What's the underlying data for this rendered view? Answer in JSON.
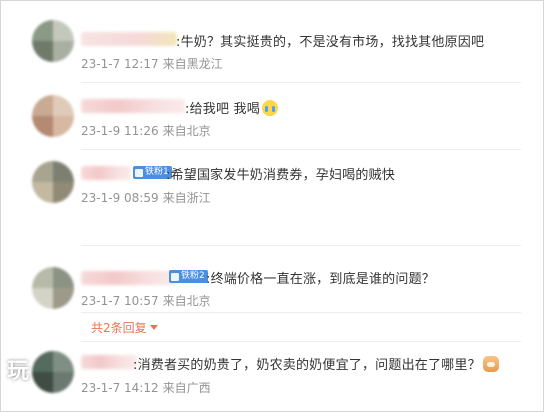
{
  "comments": [
    {
      "text": ":牛奶？其实挺贵的，不是没有市场，找找其他原因吧",
      "date": "23-1-7 12:17",
      "source": "来自黑龙江"
    },
    {
      "text": ":给我吧 我喝",
      "date": "23-1-9 11:26",
      "source": "来自北京"
    },
    {
      "text": ":希望国家发牛奶消费券，孕妇喝的贼快",
      "date": "23-1-9 08:59",
      "source": "来自浙江",
      "badge": "铁粉1"
    },
    {
      "text": ":终端价格一直在涨，到底是谁的问题？",
      "date": "23-1-7 10:57",
      "source": "来自北京",
      "badge": "铁粉2",
      "replies": "共2条回复"
    },
    {
      "text": ":消费者买的奶贵了，奶农卖的奶便宜了，问题出在了哪里？",
      "date": "23-1-7 14:12",
      "source": "来自广西"
    }
  ],
  "watermark": "玩",
  "icons": {
    "cry": "crying-face-emoji",
    "cat": "cat-emoji",
    "caret": "caret-down-icon"
  },
  "colors": {
    "meta": "#939393",
    "accent": "#eb7350",
    "badge": "#4a8fe0"
  }
}
